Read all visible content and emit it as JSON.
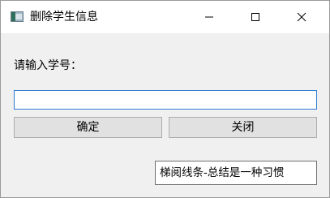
{
  "window": {
    "title": "删除学生信息",
    "app_icon": "window-app-icon",
    "controls": {
      "minimize_icon": "minimize-icon",
      "maximize_icon": "maximize-icon",
      "close_icon": "close-icon"
    }
  },
  "form": {
    "prompt_label": "请输入学号：",
    "student_id_value": "",
    "student_id_placeholder": ""
  },
  "buttons": {
    "confirm_label": "确定",
    "close_label": "关闭"
  },
  "footer": {
    "text": "梯阅线条-总结是一种习惯"
  },
  "colors": {
    "input_focus_border": "#2f7bd2",
    "button_background": "#e1e1e1",
    "window_background": "#f0f0f0"
  }
}
